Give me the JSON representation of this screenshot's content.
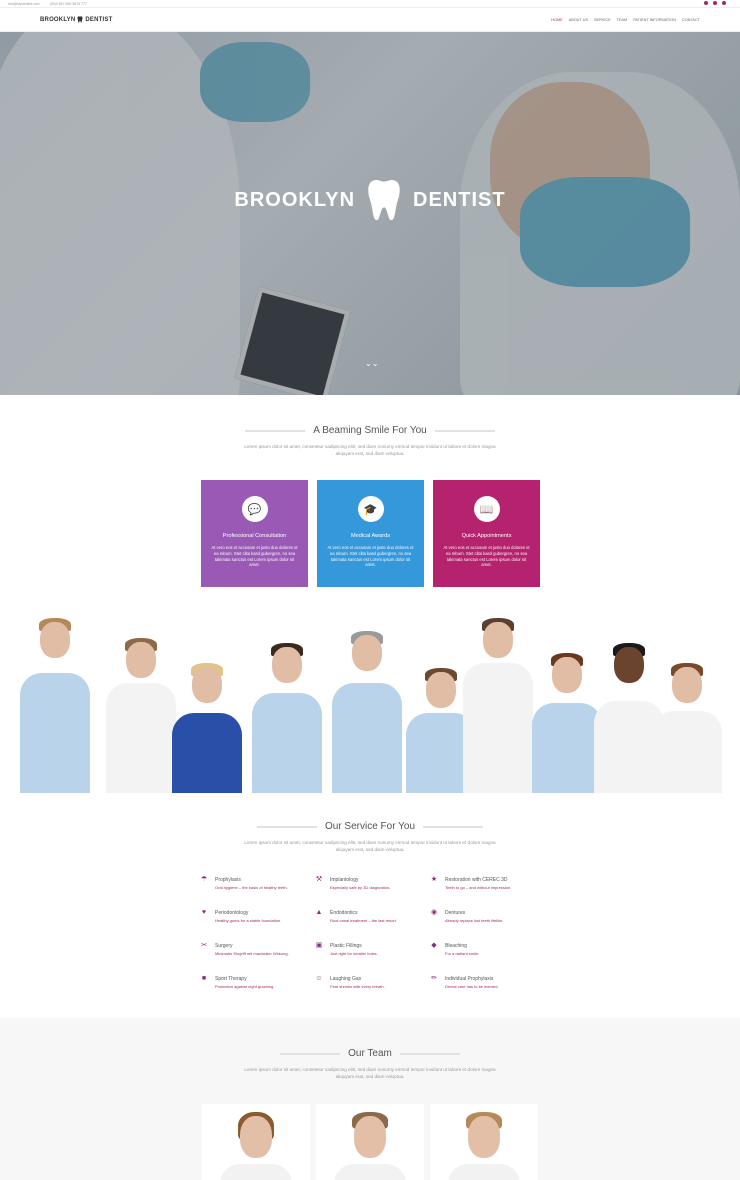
{
  "topbar": {
    "email": "info@ldydentist.com",
    "phone": "(00)9 567 890 5676 777"
  },
  "brand": {
    "name_a": "BROOKLYN",
    "name_b": "DENTIST"
  },
  "menu": [
    "HOME",
    "ABOUT US",
    "SERVICE",
    "TEAM",
    "PATIENT INFORMATION",
    "CONTACT"
  ],
  "hero": {
    "title_a": "BROOKLYN",
    "title_b": "DENTIST",
    "scroll_glyph": "⌄⌄"
  },
  "smile": {
    "title": "A Beaming Smile For You",
    "lead": "Lorem ipsum dolor sit amet, consetetur sadipscing elitr, sed diam nonumy eirmod tempor invidunt ut labore et dolore magna aliquyam erat, sed diam voluptua."
  },
  "cards": [
    {
      "title": "Professional Consultation",
      "icon": "chat-icon",
      "color": "#9b59b6",
      "text": "At vero eos et accusam et justo duo dolores et ea rebum. Stet clita kasd gubergren, no sea takimata sanctus est Lorem ipsum dolor sit amet."
    },
    {
      "title": "Medical Awards",
      "icon": "graduation-cap-icon",
      "color": "#3498db",
      "text": "At vero eos et accusam et justo duo dolores et ea rebum. Stet clita kasd gubergren, no sea takimata sanctus est Lorem ipsum dolor sit amet."
    },
    {
      "title": "Quick Appointments",
      "icon": "book-icon",
      "color": "#b5226e",
      "text": "At vero eos et accusam et justo duo dolores et ea rebum. Stet clita kasd gubergren, no sea takimata sanctus est Lorem ipsum dolor sit amet."
    }
  ],
  "service": {
    "title": "Our Service For You",
    "lead": "Lorem ipsum dolor sit amet, consetetur sadipscing elitr, sed diam nonumy eirmod tempor invidunt ut labore et dolore magna aliquyam erat, sed diam voluptua.",
    "items": [
      {
        "name": "Prophylaxis",
        "desc": "Oral hygiene – the basis of healthy teeth.",
        "icon": "umbrella-icon"
      },
      {
        "name": "Implantology",
        "desc": "Especially safe by 3D diagnostics.",
        "icon": "wrench-icon"
      },
      {
        "name": "Restoration with CEREC 3D",
        "desc": "Teeth to go – and without impression.",
        "icon": "star-icon"
      },
      {
        "name": "Periodontology",
        "desc": "Healthy gums for a stable foundation.",
        "icon": "heart-icon"
      },
      {
        "name": "Endodontics",
        "desc": "Root canal treatment – the last resort.",
        "icon": "tree-icon"
      },
      {
        "name": "Dentures",
        "desc": "Already replace lost teeth lifelike.",
        "icon": "dentures-icon"
      },
      {
        "name": "Surgery",
        "desc": "Minimaler Eingriff mit maximaler Wirkung.",
        "icon": "scissors-icon"
      },
      {
        "name": "Plastic Fillings",
        "desc": "Just right for smaller holes.",
        "icon": "briefcase-icon"
      },
      {
        "name": "Bleaching",
        "desc": "For a radiant smile.",
        "icon": "diamond-icon"
      },
      {
        "name": "Sport Therapy",
        "desc": "Protection against night grashing.",
        "icon": "mouthguard-icon"
      },
      {
        "name": "Laughing Gas",
        "desc": "Fear shrinks with every breath.",
        "icon": "smile-icon"
      },
      {
        "name": "Individual Prophylaxis",
        "desc": "Dental care has to be learned.",
        "icon": "brush-icon"
      }
    ]
  },
  "team": {
    "title": "Our Team",
    "lead": "Lorem ipsum dolor sit amet, consetetur sadipscing elitr, sed diam nonumy eirmod tempor invidunt ut labore et dolore magna aliquyam erat, sed diam voluptua."
  },
  "colors": {
    "accent": "#a22b5f",
    "purple": "#9b59b6",
    "blue": "#3498db",
    "magenta": "#b5226e"
  }
}
